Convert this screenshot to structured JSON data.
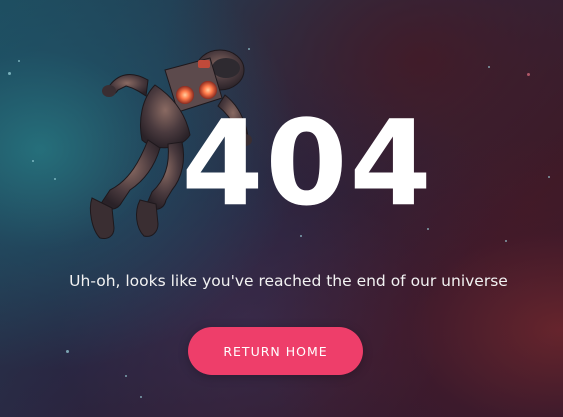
{
  "error_code": "404",
  "message": "Uh-oh, looks like you've reached the end of our universe",
  "return_button_label": "RETURN HOME",
  "colors": {
    "accent": "#ee3e6a",
    "text": "#ffffff"
  },
  "illustration": "astronaut-illustration"
}
